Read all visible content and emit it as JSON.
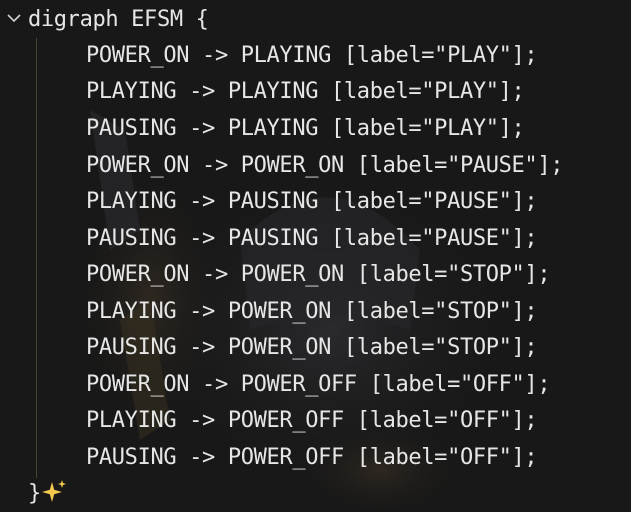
{
  "code": {
    "header": "digraph EFSM {",
    "lines": [
      "POWER_ON -> PLAYING [label=\"PLAY\"];",
      "PLAYING -> PLAYING [label=\"PLAY\"];",
      "PAUSING -> PLAYING [label=\"PLAY\"];",
      "POWER_ON -> POWER_ON [label=\"PAUSE\"];",
      "PLAYING -> PAUSING [label=\"PAUSE\"];",
      "PAUSING -> PAUSING [label=\"PAUSE\"];",
      "POWER_ON -> POWER_ON [label=\"STOP\"];",
      "PLAYING -> POWER_ON [label=\"STOP\"];",
      "PAUSING -> POWER_ON [label=\"STOP\"];",
      "POWER_ON -> POWER_OFF [label=\"OFF\"];",
      "PLAYING -> POWER_OFF [label=\"OFF\"];",
      "PAUSING -> POWER_OFF [label=\"OFF\"];"
    ],
    "footer": "}"
  },
  "colors": {
    "background": "#181818",
    "text": "#e6e6e6",
    "fold_icon": "#cfcfcf",
    "indent_guide": "#5a5a3a",
    "sparkle": "#f2c94c"
  },
  "icons": {
    "fold": "chevron-down-icon",
    "ai_assist": "sparkle-icon"
  }
}
